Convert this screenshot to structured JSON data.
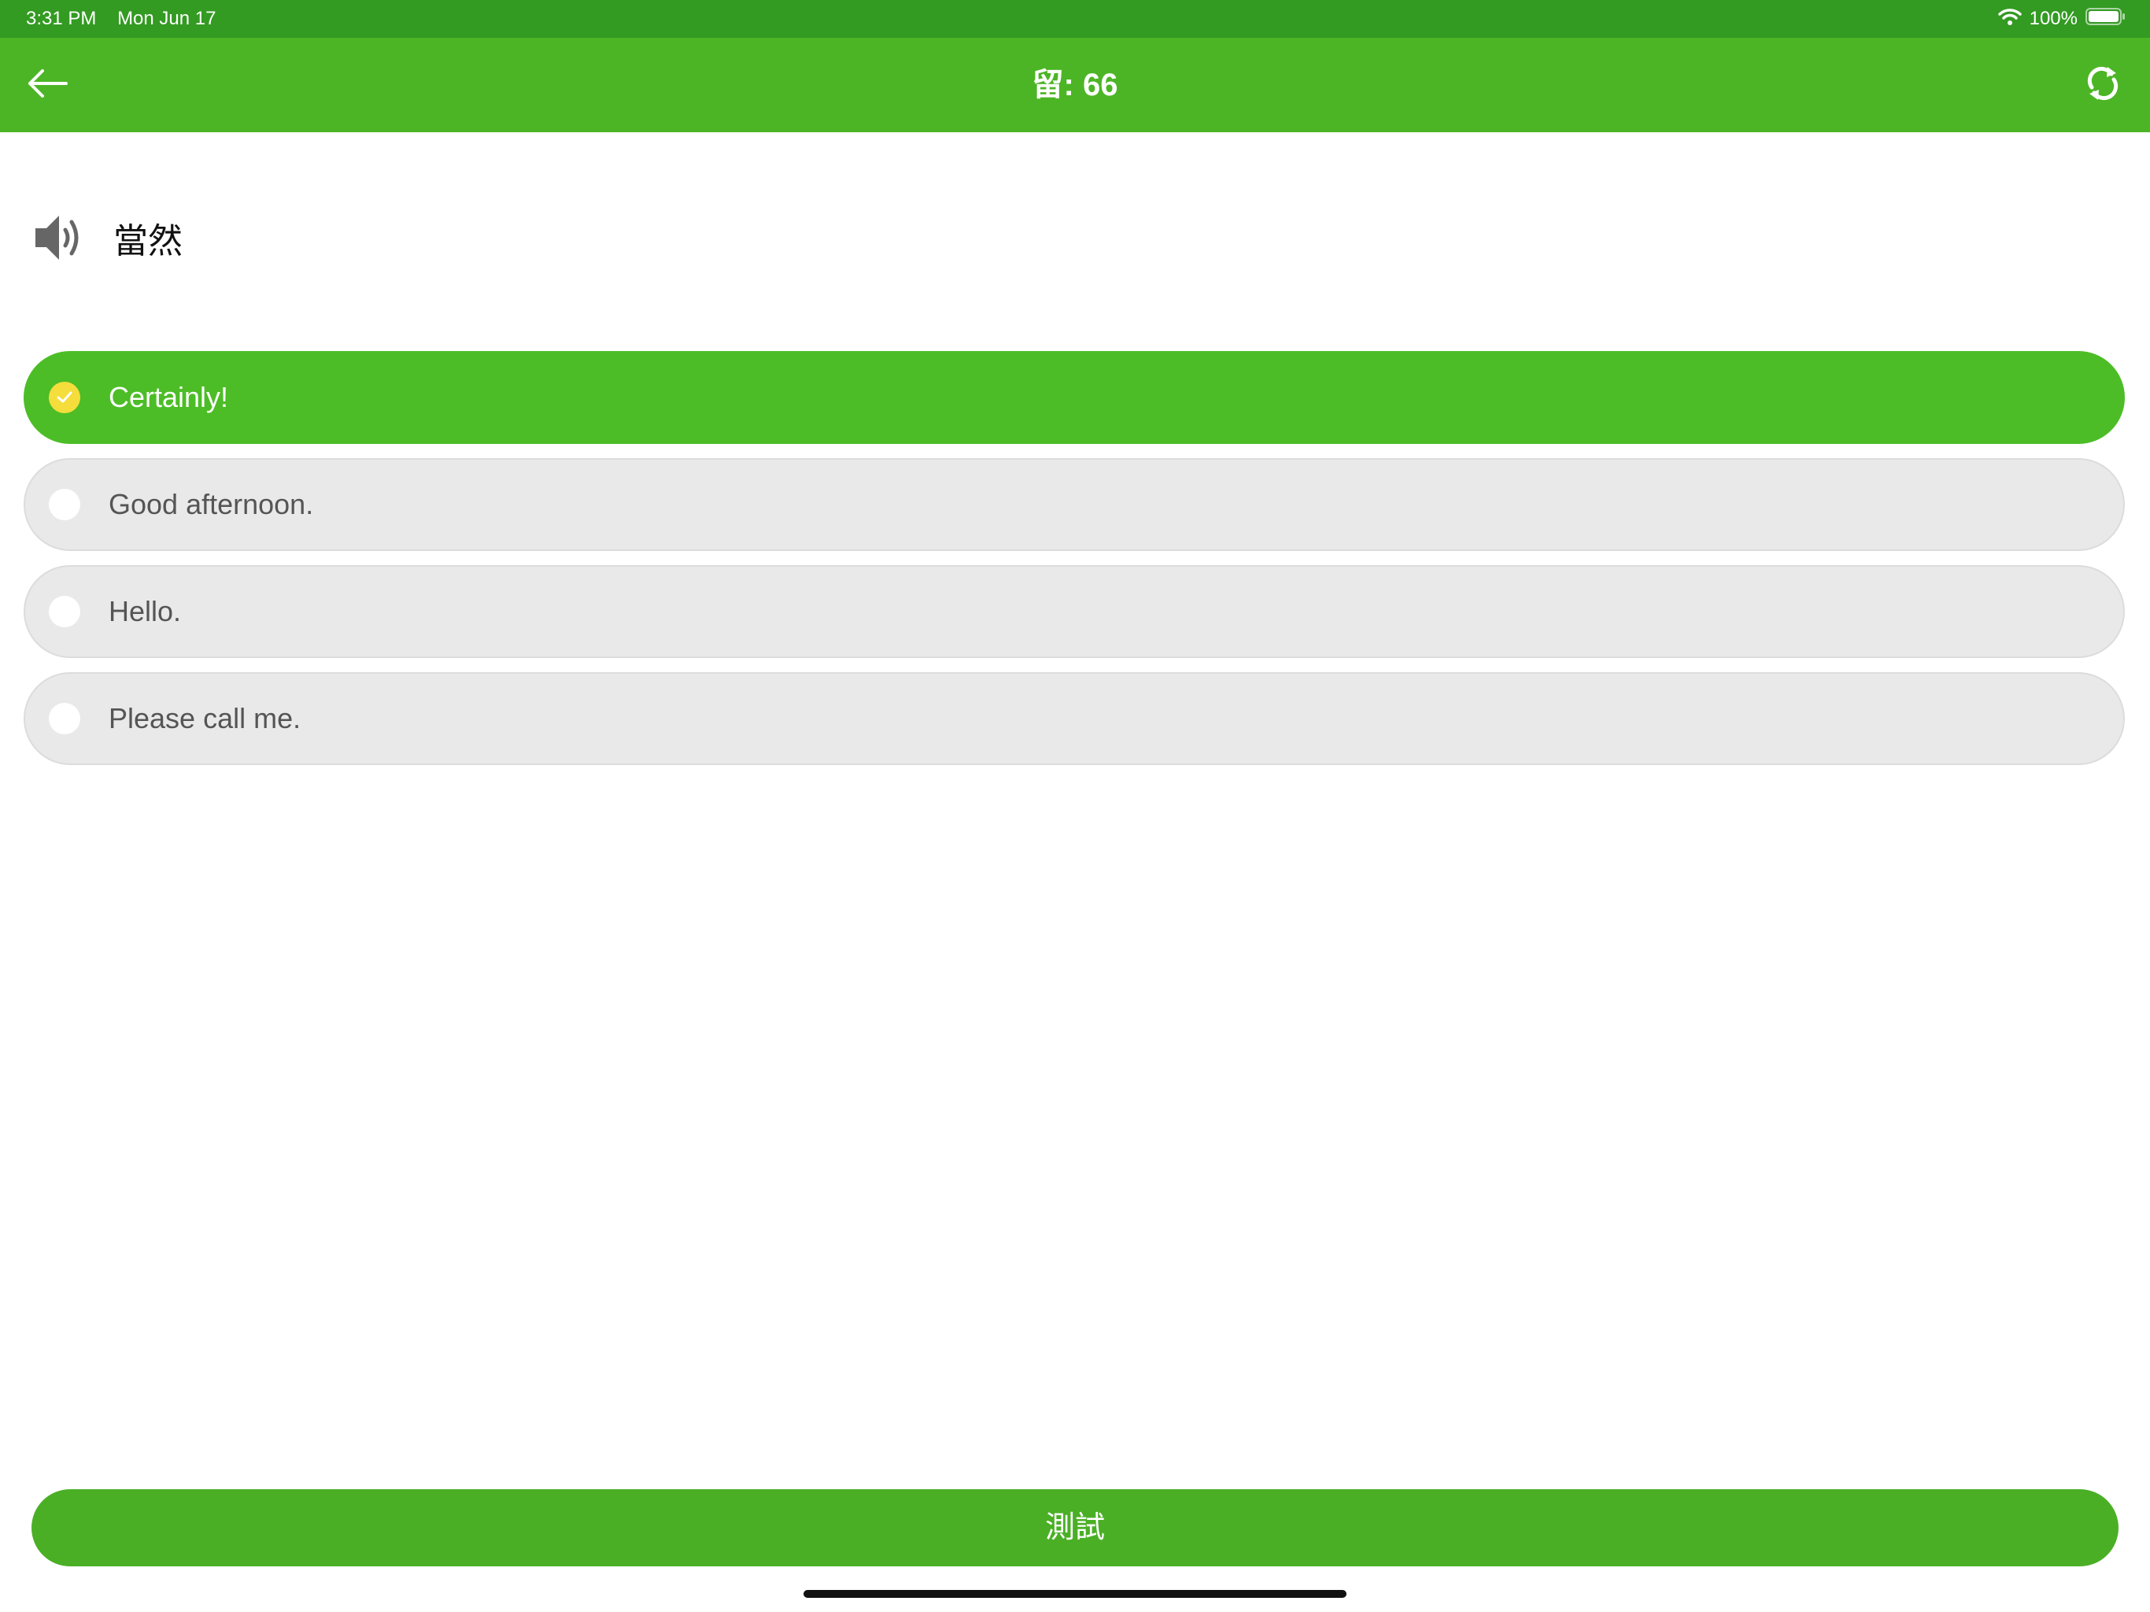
{
  "status_bar": {
    "time": "3:31 PM",
    "date": "Mon Jun 17",
    "battery": "100%",
    "icons": [
      "wifi-icon",
      "battery-icon"
    ]
  },
  "header": {
    "title": "留: 66",
    "back_icon": "back-arrow-icon",
    "refresh_icon": "refresh-icon"
  },
  "question": {
    "audio_icon": "speaker-icon",
    "word": "當然"
  },
  "options": [
    {
      "label": "Certainly!",
      "selected": true
    },
    {
      "label": "Good afternoon.",
      "selected": false
    },
    {
      "label": "Hello.",
      "selected": false
    },
    {
      "label": "Please call me.",
      "selected": false
    }
  ],
  "footer": {
    "test_button_label": "測試"
  },
  "colors": {
    "status_bar": "#339a22",
    "header": "#4cb525",
    "selected_option": "#4cbd26",
    "unselected_option": "#e9e9e9",
    "check_circle": "#f5dd3b",
    "test_button": "#4aaf25"
  }
}
